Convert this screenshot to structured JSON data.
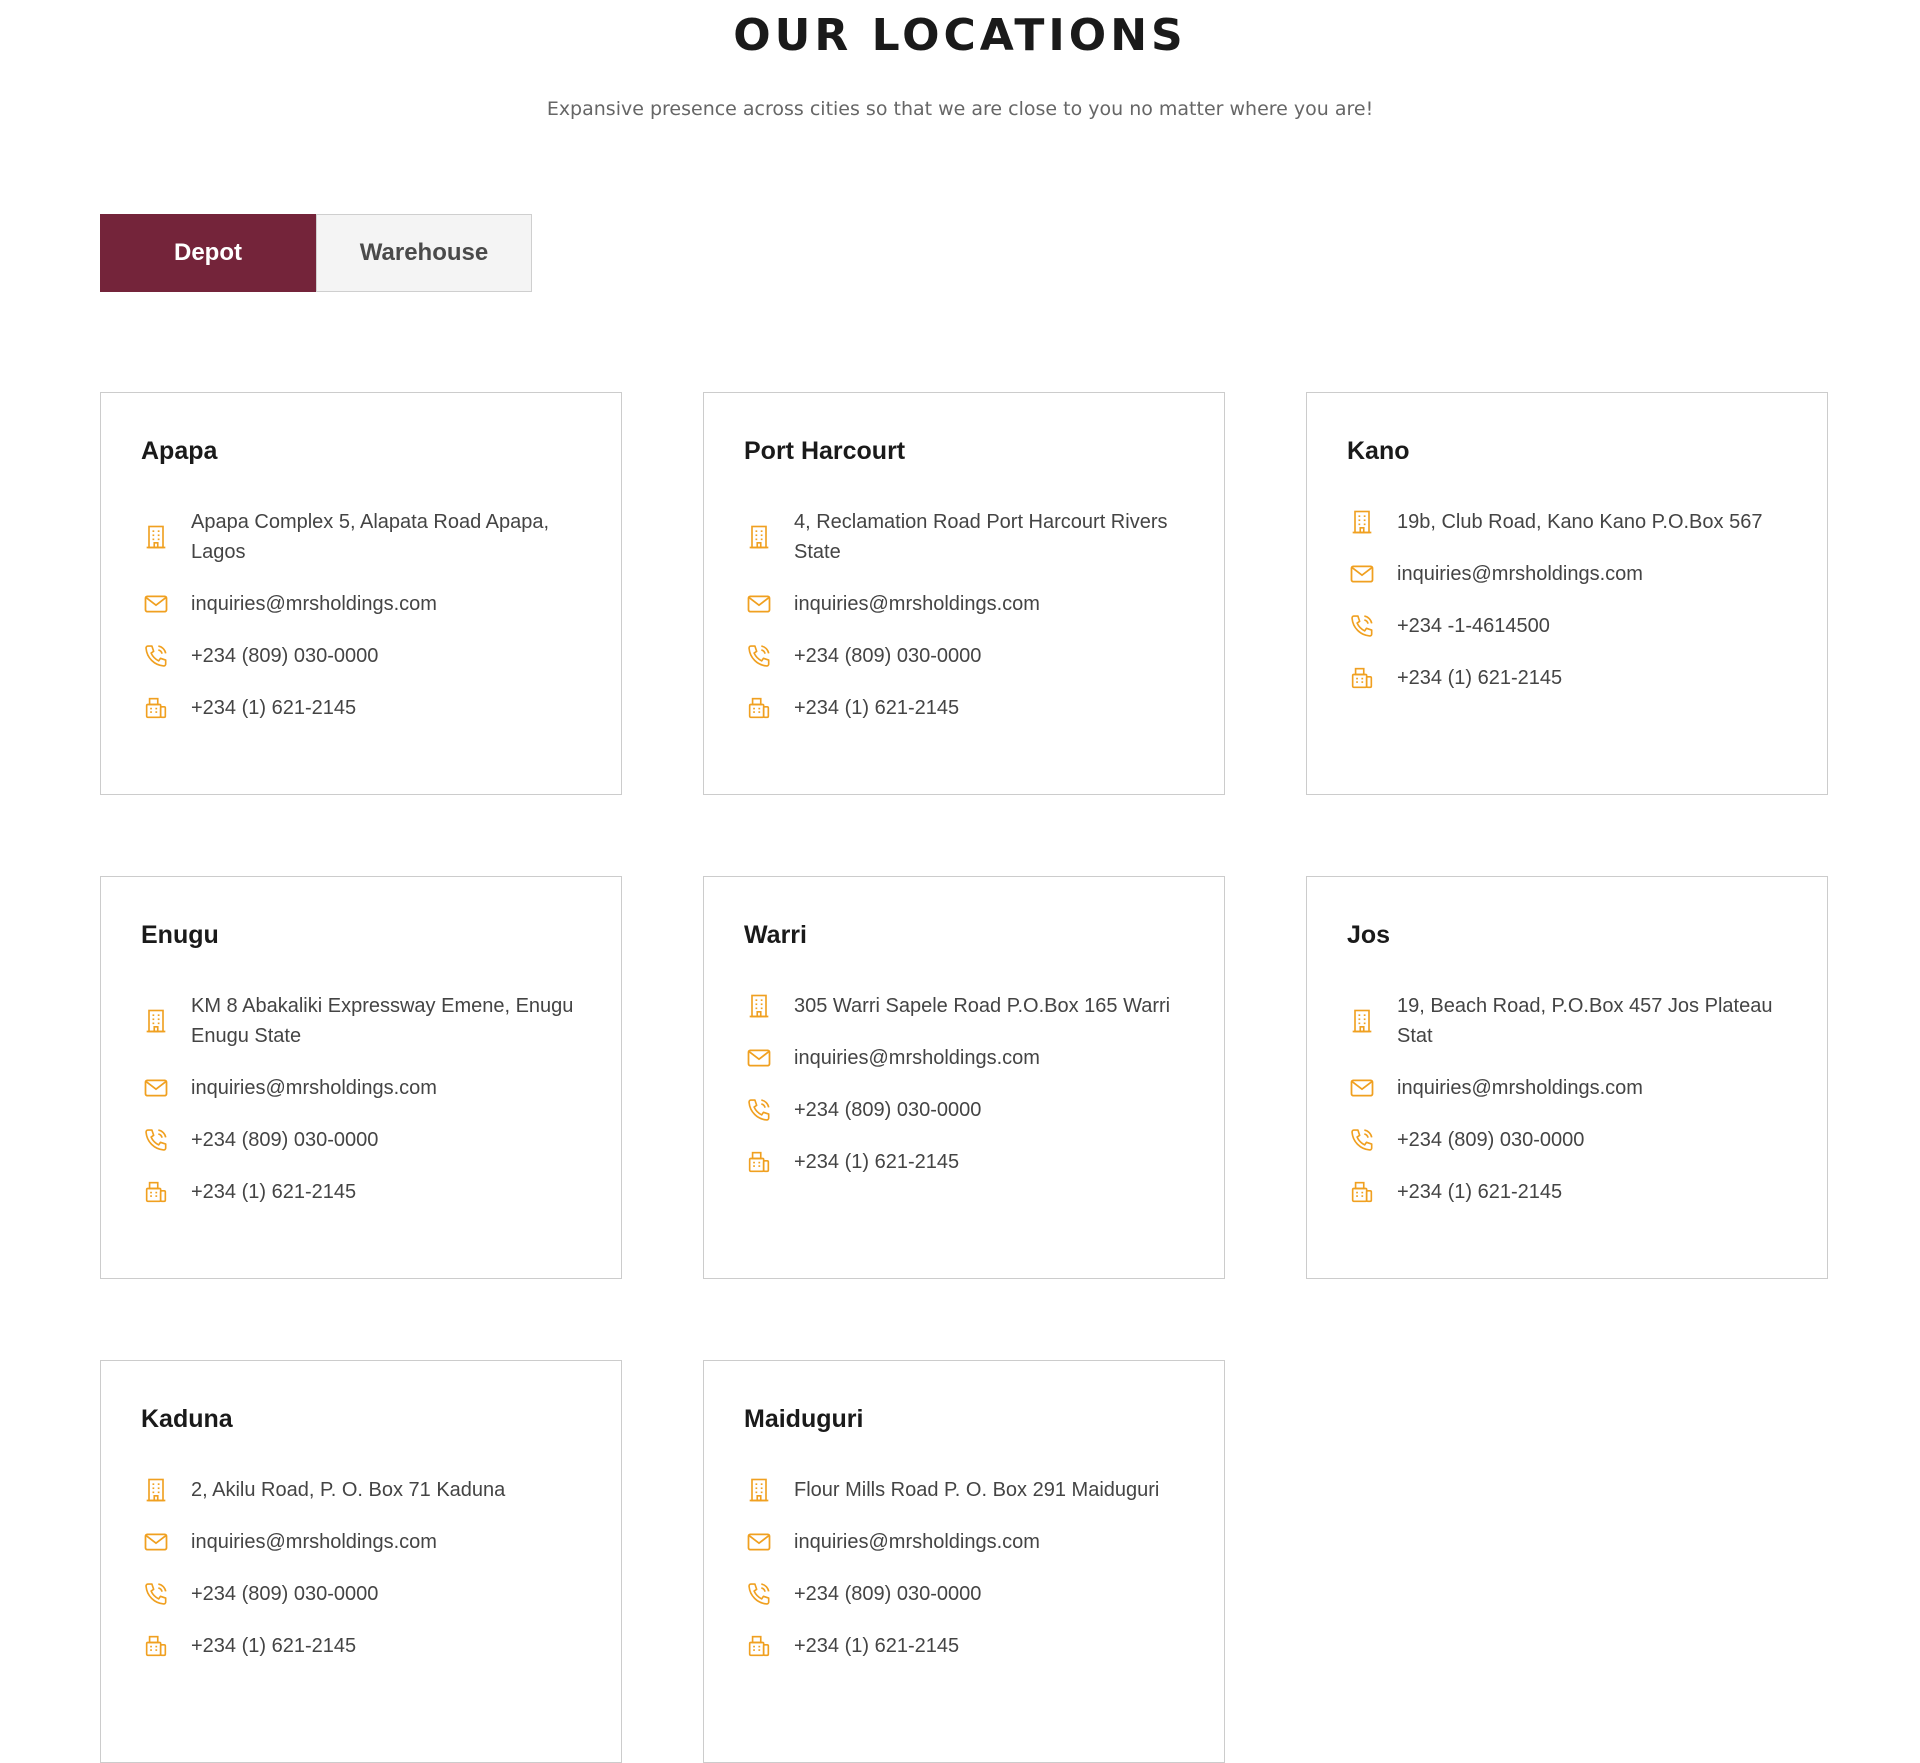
{
  "header": {
    "title": "OUR LOCATIONS",
    "subtitle": "Expansive presence across cities so that we are close to you no matter where you are!"
  },
  "tabs": [
    {
      "label": "Depot",
      "active": true
    },
    {
      "label": "Warehouse",
      "active": false
    }
  ],
  "colors": {
    "accent": "#74243a",
    "icon": "#f0a020"
  },
  "icons": {
    "address": "building-icon",
    "email": "envelope-icon",
    "phone": "phone-icon",
    "fax": "fax-icon"
  },
  "locations": [
    {
      "name": "Apapa",
      "address": "Apapa Complex 5, Alapata Road Apapa, Lagos",
      "email": "inquiries@mrsholdings.com",
      "phone": "+234 (809) 030-0000",
      "fax": "+234 (1) 621-2145"
    },
    {
      "name": "Port Harcourt",
      "address": "4, Reclamation Road Port Harcourt Rivers State",
      "email": "inquiries@mrsholdings.com",
      "phone": "+234 (809) 030-0000",
      "fax": "+234 (1) 621-2145"
    },
    {
      "name": "Kano",
      "address": "19b, Club Road, Kano Kano P.O.Box 567",
      "email": "inquiries@mrsholdings.com",
      "phone": "+234 -1-4614500",
      "fax": "+234 (1) 621-2145"
    },
    {
      "name": "Enugu",
      "address": "KM 8 Abakaliki Expressway Emene, Enugu Enugu State",
      "email": "inquiries@mrsholdings.com",
      "phone": "+234 (809) 030-0000",
      "fax": "+234 (1) 621-2145"
    },
    {
      "name": "Warri",
      "address": "305 Warri Sapele Road P.O.Box 165 Warri",
      "email": "inquiries@mrsholdings.com",
      "phone": "+234 (809) 030-0000",
      "fax": "+234 (1) 621-2145"
    },
    {
      "name": "Jos",
      "address": "19, Beach Road, P.O.Box 457 Jos Plateau Stat",
      "email": "inquiries@mrsholdings.com",
      "phone": "+234 (809) 030-0000",
      "fax": "+234 (1) 621-2145"
    },
    {
      "name": "Kaduna",
      "address": "2, Akilu Road, P. O. Box 71 Kaduna",
      "email": "inquiries@mrsholdings.com",
      "phone": "+234 (809) 030-0000",
      "fax": "+234 (1) 621-2145"
    },
    {
      "name": "Maiduguri",
      "address": "Flour Mills Road P. O. Box 291 Maiduguri",
      "email": "inquiries@mrsholdings.com",
      "phone": "+234 (809) 030-0000",
      "fax": "+234 (1) 621-2145"
    }
  ]
}
